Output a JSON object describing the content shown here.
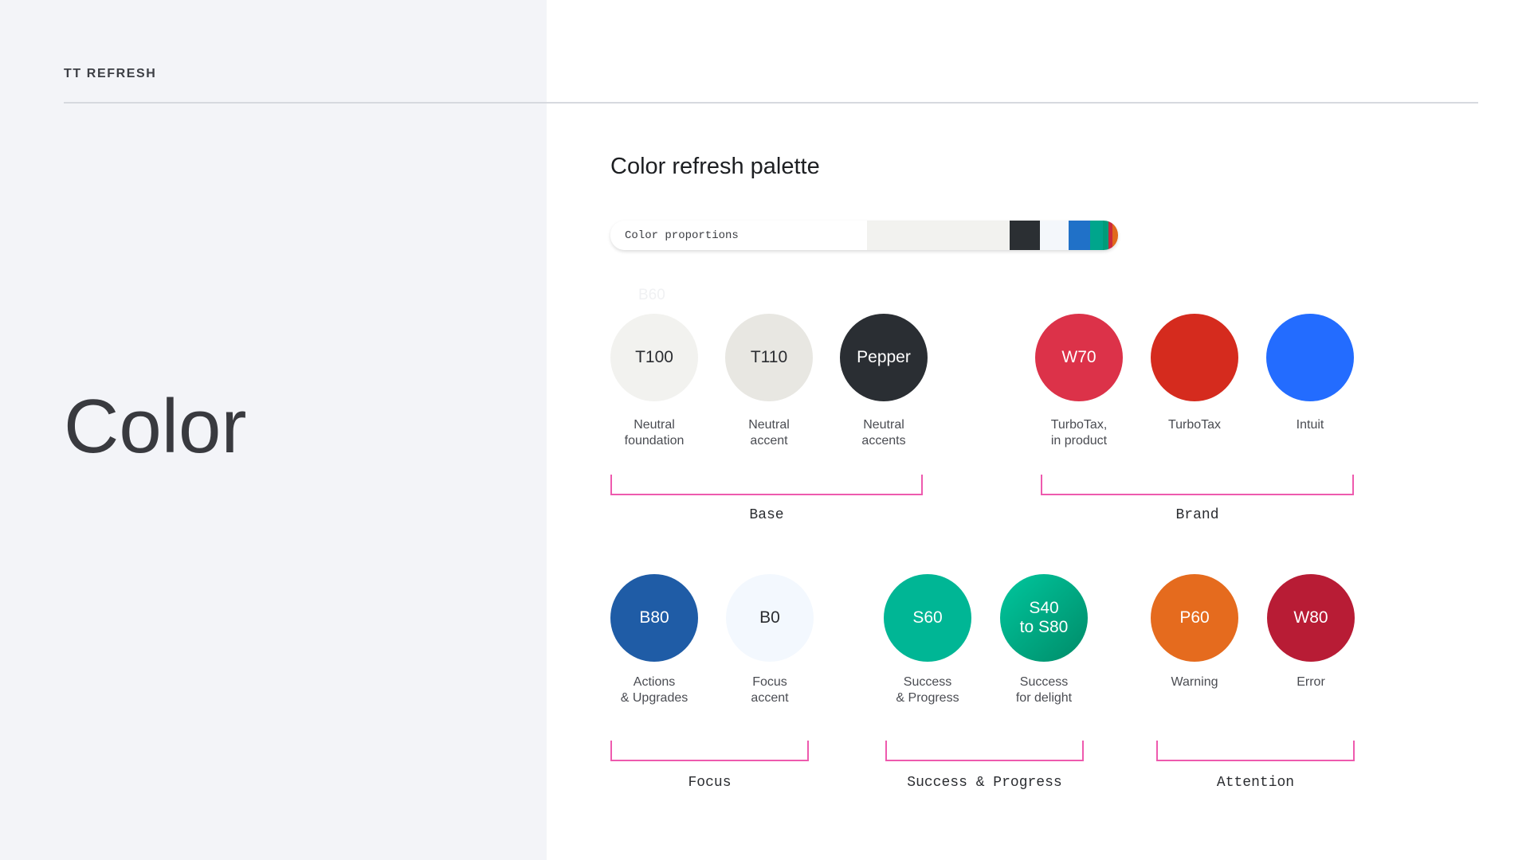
{
  "header": {
    "brand": "TT REFRESH"
  },
  "page": {
    "title": "Color"
  },
  "palette": {
    "heading": "Color refresh palette",
    "proportions_label": "Color proportions",
    "ghost_label": "B60"
  },
  "proportions": [
    {
      "color": "#f2f2ef",
      "share": 0.281
    },
    {
      "color": "#2b2f33",
      "share": 0.06
    },
    {
      "color": "#f4f7fb",
      "share": 0.056
    },
    {
      "color": "#2071c8",
      "share": 0.042
    },
    {
      "color": "#00a58c",
      "share": 0.025
    },
    {
      "color": "#009c7a",
      "share": 0.011
    },
    {
      "color": "#cc2a3c",
      "share": 0.008
    },
    {
      "color": "#e06a1c",
      "share": 0.011
    }
  ],
  "swatches": [
    {
      "label": "T100",
      "caption": "Neutral\nfoundation",
      "color": "#f2f2ef",
      "text_color": "#2b2d31"
    },
    {
      "label": "T110",
      "caption": "Neutral\naccent",
      "color": "#e8e7e2",
      "text_color": "#2b2d31"
    },
    {
      "label": "Pepper",
      "caption": "Neutral\naccents",
      "color": "#2a2e33",
      "text_color": "#ffffff"
    },
    {
      "label": "W70",
      "caption": "TurboTax,\nin product",
      "color": "#dc3249",
      "text_color": "#ffffff"
    },
    {
      "label": "",
      "caption": "TurboTax",
      "color": "#d52b1e",
      "text_color": "#ffffff"
    },
    {
      "label": "",
      "caption": "Intuit",
      "color": "#236cff",
      "text_color": "#ffffff"
    },
    {
      "label": "B80",
      "caption": "Actions\n& Upgrades",
      "color": "#1f5ca6",
      "text_color": "#ffffff"
    },
    {
      "label": "B0",
      "caption": "Focus\naccent",
      "color": "#f3f8fe",
      "text_color": "#2b2d31"
    },
    {
      "label": "S60",
      "caption": "Success\n& Progress",
      "color": "#00b695",
      "text_color": "#ffffff"
    },
    {
      "label": "S40\nto S80",
      "caption": "Success\nfor delight",
      "color": "#00c79e",
      "color2": "#008b68",
      "text_color": "#ffffff"
    },
    {
      "label": "P60",
      "caption": "Warning",
      "color": "#e56b1e",
      "text_color": "#ffffff"
    },
    {
      "label": "W80",
      "caption": "Error",
      "color": "#b81c35",
      "text_color": "#ffffff"
    }
  ],
  "groups": [
    {
      "label": "Base"
    },
    {
      "label": "Brand"
    },
    {
      "label": "Focus"
    },
    {
      "label": "Success & Progress"
    },
    {
      "label": "Attention"
    }
  ],
  "accent_color": "#ee5aae"
}
